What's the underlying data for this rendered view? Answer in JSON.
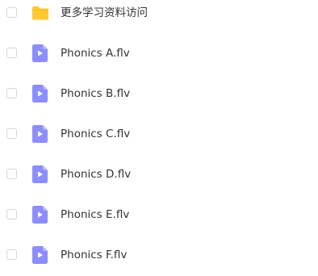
{
  "files": [
    {
      "name": "更多学习资料访问",
      "type": "folder",
      "icon": "folder-icon"
    },
    {
      "name": "Phonics A.flv",
      "type": "video",
      "icon": "video-file-icon"
    },
    {
      "name": "Phonics B.flv",
      "type": "video",
      "icon": "video-file-icon"
    },
    {
      "name": "Phonics C.flv",
      "type": "video",
      "icon": "video-file-icon"
    },
    {
      "name": "Phonics D.flv",
      "type": "video",
      "icon": "video-file-icon"
    },
    {
      "name": "Phonics E.flv",
      "type": "video",
      "icon": "video-file-icon"
    },
    {
      "name": "Phonics F.flv",
      "type": "video",
      "icon": "video-file-icon"
    }
  ],
  "colors": {
    "folder": "#FFC933",
    "video": "#8C8DFE",
    "text": "#333333",
    "checkbox_border": "#D6D6D6"
  }
}
